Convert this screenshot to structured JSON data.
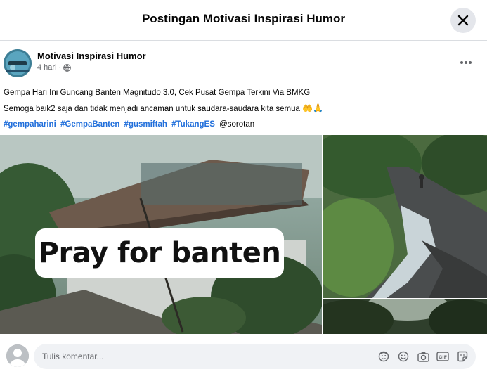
{
  "header": {
    "title": "Postingan Motivasi Inspirasi Humor",
    "close_icon": "close-icon"
  },
  "post": {
    "author": "Motivasi Inspirasi Humor",
    "time": "4 hari",
    "separator": "·",
    "audience_icon": "globe-icon",
    "more_icon": "more-horizontal-icon",
    "line1": "Gempa Hari Ini Guncang Banten Magnitudo 3.0, Cek Pusat Gempa Terkini Via BMKG",
    "line2": "Semoga baik2 saja dan tidak menjadi ancaman untuk saudara-saudara kita semua",
    "line2_emoji": "🤲🙏",
    "hashtags": [
      "#gempaharini",
      "#GempaBanten",
      "#gusmiftah",
      "#TukangES"
    ],
    "mention": "@sorotan"
  },
  "gallery": {
    "overlay_text": "Pray for banten"
  },
  "comment": {
    "placeholder": "Tulis komentar...",
    "icons": [
      "sticker-icon",
      "emoji-icon",
      "camera-icon",
      "gif-icon",
      "sticker-alt-icon"
    ]
  },
  "colors": {
    "link": "#216fdb",
    "secondary_text": "#65676b",
    "button_bg": "#e4e6eb",
    "input_bg": "#f0f2f5"
  }
}
